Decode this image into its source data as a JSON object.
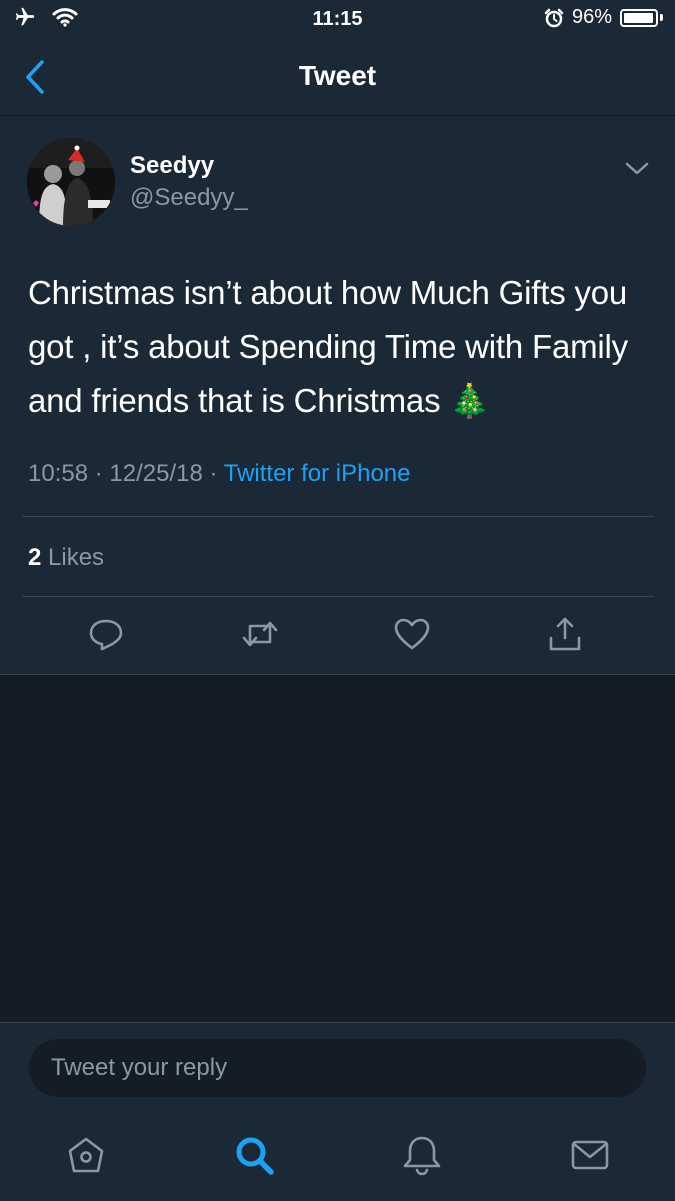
{
  "status_bar": {
    "time": "11:15",
    "battery_percent": "96%",
    "battery_level": 0.96
  },
  "nav": {
    "title": "Tweet"
  },
  "tweet": {
    "author_name": "Seedyy",
    "author_handle": "@Seedyy_",
    "text": "Christmas isn’t about how Much Gifts you got , it’s about Spending Time with Family and friends that is Christmas 🎄",
    "time": "10:58",
    "date": "12/25/18",
    "source": "Twitter for iPhone",
    "likes_count": "2",
    "likes_label": "Likes"
  },
  "reply": {
    "placeholder": "Tweet your reply"
  },
  "colors": {
    "accent": "#1da1f2",
    "background": "#141d26",
    "card": "#1b2836",
    "secondary_text": "#8899a6"
  }
}
